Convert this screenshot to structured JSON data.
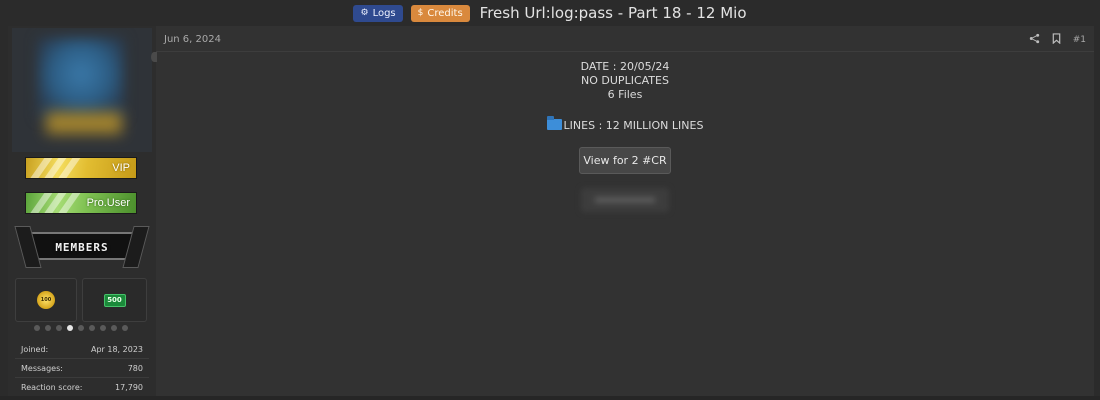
{
  "thread": {
    "prefixes": [
      {
        "icon": "settings-icon",
        "label": "Logs",
        "color": "#2f4a8f"
      },
      {
        "icon": "dollar-icon",
        "label": "Credits",
        "color": "#d9893d"
      }
    ],
    "title": "Fresh Url:log:pass - Part 18 - 12 Mio"
  },
  "user": {
    "banners": [
      "VIP",
      "Pro.User"
    ],
    "members_banner": "MEMBERS",
    "trophies": [
      {
        "icon": "gold-award-icon",
        "text": "100"
      },
      {
        "icon": "green-500-icon",
        "text": "500"
      }
    ],
    "carousel": {
      "count": 9,
      "active_index": 3
    },
    "stats": [
      {
        "label": "Joined:",
        "value": "Apr 18, 2023"
      },
      {
        "label": "Messages:",
        "value": "780"
      },
      {
        "label": "Reaction score:",
        "value": "17,790"
      }
    ]
  },
  "post": {
    "date": "Jun 6, 2024",
    "number": "#1",
    "actions": [
      "share-icon",
      "bookmark-icon"
    ],
    "lines": [
      "DATE : 20/05/24",
      "NO DUPLICATES",
      "6 Files"
    ],
    "lines_info": "LINES : 12 MILLION LINES",
    "unlock_button": "View for 2 #CR"
  },
  "colors": {
    "background": "#2b2b2b",
    "post_bg": "#323232",
    "logs_prefix": "#2f4a8f",
    "credits_prefix": "#d9893d"
  }
}
